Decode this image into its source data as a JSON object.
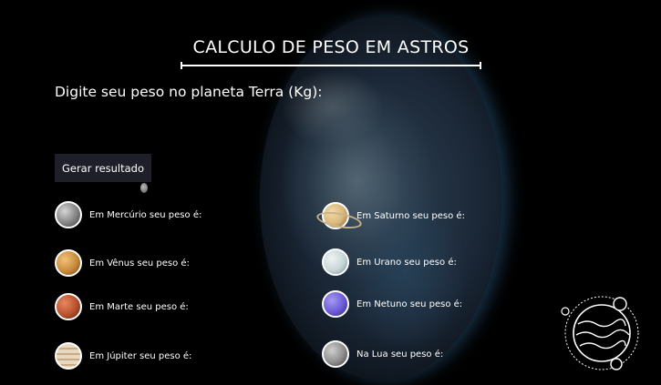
{
  "header": {
    "title": "CALCULO DE PESO EM ASTROS"
  },
  "form": {
    "prompt": "Digite seu peso no planeta Terra (Kg):",
    "button_label": "Gerar resultado"
  },
  "results_left": [
    {
      "icon": "mercury-icon",
      "label": "Em Mercúrio seu peso é:",
      "color": "#9a9a9a"
    },
    {
      "icon": "venus-icon",
      "label": "Em Vênus seu peso é:",
      "color": "#c98a3a"
    },
    {
      "icon": "mars-icon",
      "label": "Em Marte seu peso é:",
      "color": "#b8502e"
    },
    {
      "icon": "jupiter-icon",
      "label": "Em Júpiter seu peso é:",
      "color": "#d7c2a4"
    }
  ],
  "results_right": [
    {
      "icon": "saturn-icon",
      "label": "Em Saturno seu peso é:",
      "color": "#d9b77a"
    },
    {
      "icon": "uranus-icon",
      "label": "Em Urano seu peso é:",
      "color": "#c8d6d9"
    },
    {
      "icon": "neptune-icon",
      "label": "Em Netuno seu peso é:",
      "color": "#6a5ad6"
    },
    {
      "icon": "moon-icon",
      "label": "Na Lua seu peso é:",
      "color": "#8d8d8d"
    }
  ]
}
